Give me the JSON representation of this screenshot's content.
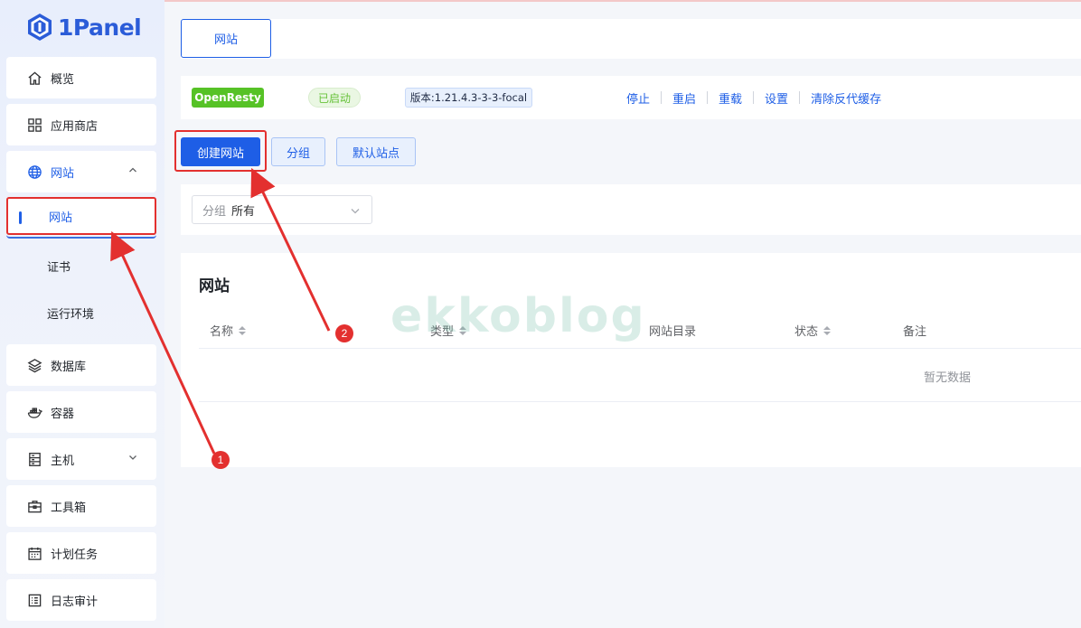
{
  "brand": {
    "name": "1Panel"
  },
  "sidebar": {
    "items": [
      {
        "label": "概览",
        "icon": "home-icon"
      },
      {
        "label": "应用商店",
        "icon": "apps-grid-icon"
      },
      {
        "label": "网站",
        "icon": "globe-icon",
        "expanded": true
      },
      {
        "label": "数据库",
        "icon": "layers-icon"
      },
      {
        "label": "容器",
        "icon": "docker-icon"
      },
      {
        "label": "主机",
        "icon": "server-icon"
      },
      {
        "label": "工具箱",
        "icon": "toolbox-icon"
      },
      {
        "label": "计划任务",
        "icon": "calendar-icon"
      },
      {
        "label": "日志审计",
        "icon": "log-icon"
      }
    ],
    "website_sub": [
      {
        "label": "网站",
        "active": true
      },
      {
        "label": "证书"
      },
      {
        "label": "运行环境"
      }
    ]
  },
  "tabs": {
    "website": "网站"
  },
  "status": {
    "app": "OpenResty",
    "state": "已启动",
    "version": "版本:1.21.4.3-3-3-focal",
    "ops": [
      "停止",
      "重启",
      "重载",
      "设置",
      "清除反代缓存"
    ]
  },
  "actions": {
    "create": "创建网站",
    "group": "分组",
    "default_site": "默认站点"
  },
  "filter": {
    "label": "分组",
    "value": "所有"
  },
  "table": {
    "title": "网站",
    "columns": [
      "名称",
      "类型",
      "网站目录",
      "状态",
      "备注"
    ],
    "empty": "暂无数据"
  },
  "watermark": "ekkoblog",
  "annotations": [
    "1",
    "2"
  ],
  "colors": {
    "primary": "#1e5ee6",
    "success": "#56c226",
    "highlight": "#e3302f"
  }
}
